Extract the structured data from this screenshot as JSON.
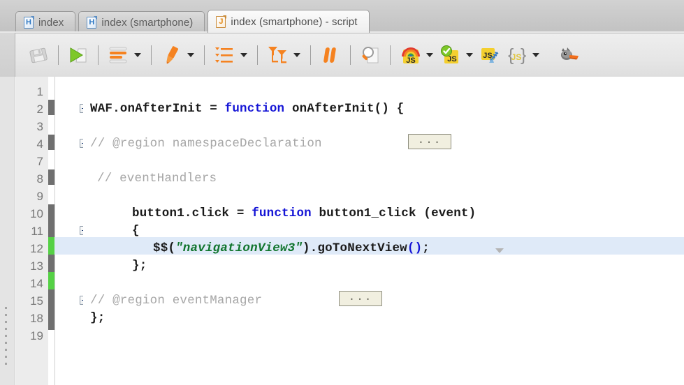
{
  "tabs": [
    {
      "label": "index",
      "icon": "html-document-icon",
      "letter": "H",
      "kind": "html",
      "active": false
    },
    {
      "label": "index (smartphone)",
      "icon": "html-document-icon",
      "letter": "H",
      "kind": "html",
      "active": false
    },
    {
      "label": "index (smartphone) - script",
      "icon": "js-document-icon",
      "letter": "J",
      "kind": "js",
      "active": true
    }
  ],
  "toolbar": {
    "items": [
      {
        "name": "save-button",
        "icon": "floppy-disk-save-icon",
        "dropdown": false,
        "disabled": true
      },
      {
        "name": "run-button",
        "icon": "green-play-run-icon",
        "dropdown": false,
        "disabled": false
      },
      {
        "name": "format-code-button",
        "icon": "orange-lines-format-icon",
        "dropdown": true,
        "disabled": false
      },
      {
        "name": "highlight-button",
        "icon": "orange-marker-pen-icon",
        "dropdown": true,
        "disabled": false
      },
      {
        "name": "outline-list-button",
        "icon": "orange-bulleted-list-icon",
        "dropdown": true,
        "disabled": false
      },
      {
        "name": "filter-sort-button",
        "icon": "orange-funnel-filter-icon",
        "dropdown": true,
        "disabled": false
      },
      {
        "name": "pause-breakpoint-button",
        "icon": "orange-pause-bars-icon",
        "dropdown": false,
        "disabled": false
      },
      {
        "name": "search-button",
        "icon": "magnifier-search-icon",
        "dropdown": false,
        "disabled": false
      },
      {
        "name": "js-colorize-button",
        "icon": "rainbow-js-icon",
        "dropdown": true,
        "disabled": false
      },
      {
        "name": "js-validate-button",
        "icon": "js-green-check-icon",
        "dropdown": true,
        "disabled": false
      },
      {
        "name": "js-compress-button",
        "icon": "js-compress-zip-icon",
        "dropdown": false,
        "disabled": false
      },
      {
        "name": "js-format-braces-button",
        "icon": "js-curly-braces-icon",
        "dropdown": true,
        "disabled": false
      },
      {
        "name": "duck-debugger-button",
        "icon": "duck-head-icon",
        "dropdown": false,
        "disabled": false
      }
    ]
  },
  "editor": {
    "gutter_numbers": [
      "1",
      "2",
      "3",
      "4",
      "7",
      "8",
      "9",
      "10",
      "11",
      "12",
      "13",
      "14",
      "15",
      "18",
      "19"
    ],
    "highlighted_line_number": "12",
    "change_markers": [
      {
        "line": "2",
        "state": "saved"
      },
      {
        "line": "4",
        "state": "saved"
      },
      {
        "line": "8",
        "state": "saved"
      },
      {
        "line": "10",
        "state": "saved"
      },
      {
        "line": "11",
        "state": "saved"
      },
      {
        "line": "12",
        "state": "modified"
      },
      {
        "line": "13",
        "state": "saved"
      },
      {
        "line": "14",
        "state": "modified"
      },
      {
        "line": "15",
        "state": "saved"
      },
      {
        "line": "18",
        "state": "saved"
      }
    ],
    "colors": {
      "keyword": "#1515d6",
      "string": "#11752e",
      "comment": "#a6a6a6",
      "text": "#1a1a1a",
      "highlight_row": "#dfeaf8",
      "change_saved": "#6f6f6f",
      "change_modified": "#55d145",
      "region_box_bg": "#f1efe0"
    },
    "collapsed_region_label": "...",
    "code": {
      "l2_a": "WAF.onAfterInit = ",
      "l2_kw": "function",
      "l2_b": " onAfterInit() {",
      "l4_comment": "// @region namespaceDeclaration",
      "l8_comment": "// eventHandlers",
      "l10_a": "button1.click = ",
      "l10_kw": "function",
      "l10_b": " button1_click (event)",
      "l11": "{",
      "l12_a": "$$(",
      "l12_str": "\"navigationView3\"",
      "l12_b": ").goToNextView",
      "l12_parens": "()",
      "l12_c": ";",
      "l13": "};",
      "l15_comment": "// @region eventManager",
      "l18": "};"
    }
  }
}
